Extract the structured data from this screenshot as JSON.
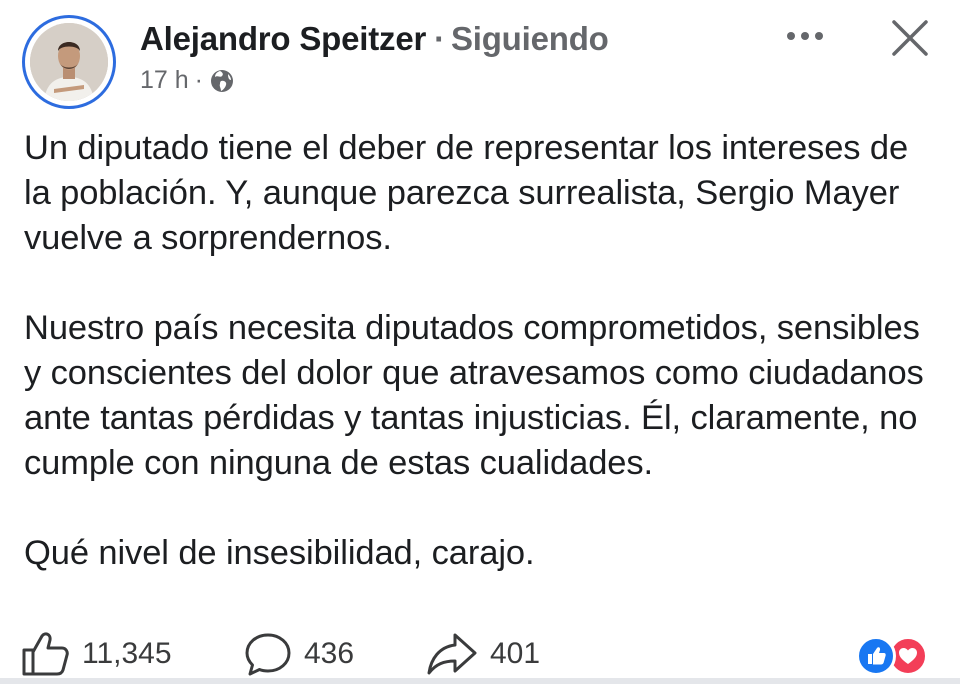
{
  "post": {
    "author": "Alejandro Speitzer",
    "separator": "·",
    "follow_status": "Siguiendo",
    "time": "17 h",
    "meta_separator": "·",
    "audience_icon": "globe-icon",
    "paragraphs": [
      "Un diputado tiene el deber de representar los intereses de la población. Y, aunque parezca surrealista, Sergio Mayer vuelve a sorprendernos.",
      "Nuestro país necesita diputados comprometidos, sensibles y conscientes del dolor que atravesamos como ciudadanos ante tantas pérdidas y tantas injusticias. Él, claramente, no cumple con ninguna de estas cualidades.",
      "Qué nivel de insesibilidad, carajo."
    ]
  },
  "stats": {
    "likes": "11,345",
    "comments": "436",
    "shares": "401"
  },
  "icons": {
    "more": "more-options-icon",
    "close": "close-icon",
    "like": "thumbs-up-icon",
    "comment": "comment-bubble-icon",
    "share": "share-arrow-icon",
    "reaction_like": "like-reaction-icon",
    "reaction_love": "love-reaction-icon"
  },
  "colors": {
    "accent": "#2d6cdf",
    "secondary_text": "#65676b",
    "like_blue": "#1877f2",
    "love_red": "#f33e58"
  }
}
